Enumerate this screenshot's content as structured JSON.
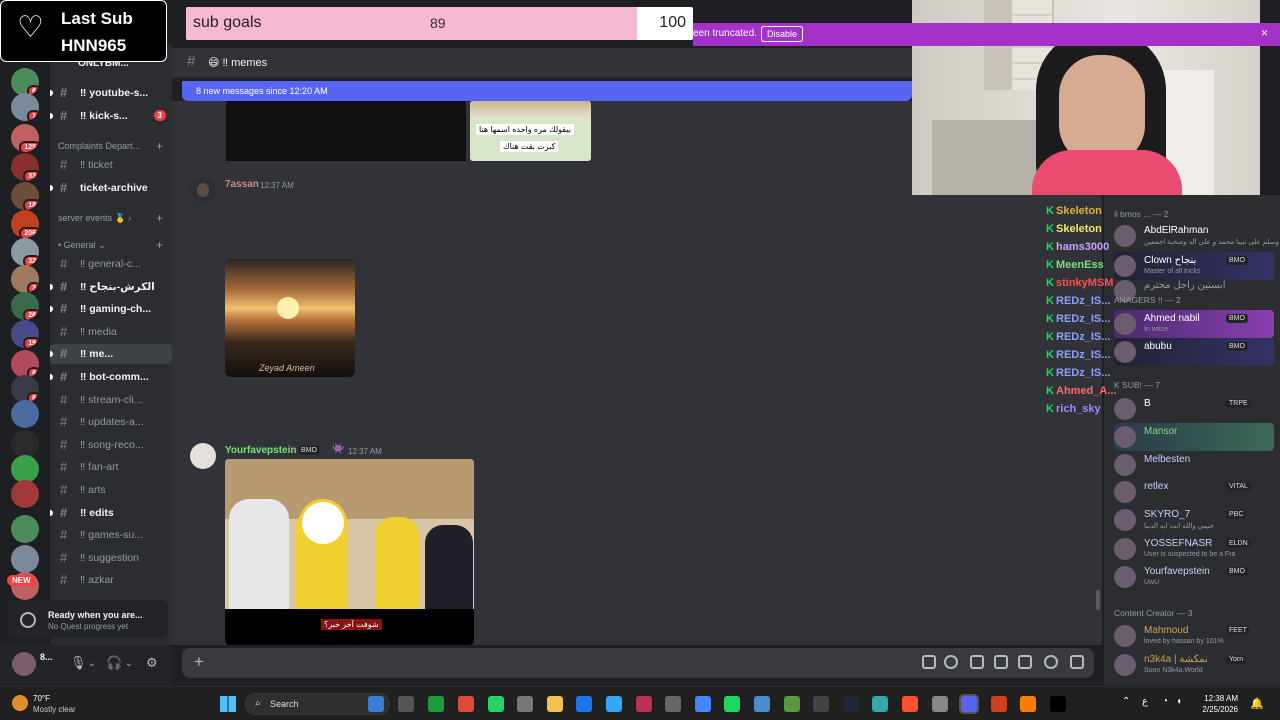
{
  "overlay": {
    "last_sub_title": "Last Sub",
    "last_sub_name": "HNN965",
    "goal_label": "sub goals",
    "goal_current": "89",
    "goal_target": "100",
    "goal_fraction": 0.89
  },
  "notice": {
    "text": "een truncated.",
    "button": "Disable"
  },
  "sidebar": {
    "server_name": "ONLYBM...",
    "channels_top": [
      {
        "label": "‼ youtube-s...",
        "icon": "heart"
      },
      {
        "label": "‼ kick-s...",
        "icon": "green-heart",
        "badge": "3"
      }
    ],
    "cat_complaints": "Complaints Depart...",
    "channels_c": [
      {
        "label": "‼ ticket"
      },
      {
        "label": "ticket-archive"
      }
    ],
    "cat_events": "server events",
    "cat_general": "General",
    "channels_g": [
      {
        "label": "‼ general-c..."
      },
      {
        "label": "‼ الكرش-بنجاح"
      },
      {
        "label": "‼ gaming-ch..."
      },
      {
        "label": "‼ media"
      },
      {
        "label": "‼ me..."
      },
      {
        "label": "‼ bot-comm..."
      },
      {
        "label": "‼ stream-cli..."
      },
      {
        "label": "‼ updates-a..."
      },
      {
        "label": "‼ song-reco..."
      },
      {
        "label": "‼ fan-art"
      },
      {
        "label": "‼ arts"
      },
      {
        "label": "‼ edits"
      },
      {
        "label": "‼ games-su..."
      },
      {
        "label": "‼ suggestion"
      },
      {
        "label": "‼ azkar"
      }
    ],
    "server_badges": [
      "6",
      "1",
      "125",
      "33",
      "18",
      "206",
      "32",
      "3",
      "26",
      "19",
      "6",
      "6"
    ],
    "new_label": "NEW",
    "quest_title": "Ready when you are...",
    "quest_sub": "No Quest progress yet",
    "user_name": "8..."
  },
  "chat": {
    "channel": "‼ memes",
    "new_messages": "8 new messages since 12:20 AM",
    "caption_top": "بيقولك مره واحده اسمها هنا",
    "caption_bottom": "كبرت بقت هناك",
    "msg1_author": "7assan",
    "msg1_time": "12:37 AM",
    "img_watermark": "Zeyad Ameen",
    "msg2_author": "Yourfavepstein",
    "msg2_tag": "BMO",
    "msg2_time": "12:37 AM",
    "video_caption": "شوفت آخر خبر؟"
  },
  "twitch": [
    {
      "name": "Skeleton",
      "color": "#e0b03a"
    },
    {
      "name": "Skeleton",
      "color": "#f2e66b"
    },
    {
      "name": "hams3000",
      "color": "#c9a0ff"
    },
    {
      "name": "MeenEss",
      "color": "#7ce07c"
    },
    {
      "name": "stinkyMSM",
      "color": "#ff4d4d"
    },
    {
      "name": "REDz_IS...",
      "color": "#8aa0ff"
    },
    {
      "name": "REDz_IS...",
      "color": "#8aa0ff"
    },
    {
      "name": "REDz_IS...",
      "color": "#8aa0ff"
    },
    {
      "name": "REDz_IS...",
      "color": "#8aa0ff"
    },
    {
      "name": "REDz_IS...",
      "color": "#8aa0ff"
    },
    {
      "name": "Ahmed_A...",
      "color": "#ff6b6b"
    },
    {
      "name": "rich_sky",
      "color": "#9b8cff"
    }
  ],
  "members": {
    "top_group": "il bmos ... — 2",
    "list1": [
      {
        "name": "AbdElRahman",
        "status": "لي وسلم على نبينا محمد و على اله وصحبة اجمعين",
        "color": "#ffffff"
      },
      {
        "name": "Clown بنجاح",
        "tag": "BMO",
        "status": "Master of all tricks",
        "color": "#ffffff"
      },
      {
        "name": "ابستين راجل محترم",
        "color": "#949ba4"
      }
    ],
    "group2": "ANAGERS !! — 2",
    "list2": [
      {
        "name": "Ahmed nabil",
        "tag": "BMO",
        "status": "In voice",
        "color": "#ffffff"
      },
      {
        "name": "abubu",
        "tag": "BMO",
        "color": "#ffffff"
      }
    ],
    "group3": "K SUB! — 7",
    "list3": [
      {
        "name": "B",
        "tag": "TRPE",
        "color": "#ffffff"
      },
      {
        "name": "Mansor",
        "color": "#7ce07c"
      },
      {
        "name": "Melbesten",
        "color": "#c7d0ff"
      },
      {
        "name": "retlex",
        "tag": "VITAL",
        "color": "#c7d0ff"
      },
      {
        "name": "SKYRO_7",
        "tag": "PBC",
        "status": "حبيبي والله انت ايه الدنيا",
        "color": "#c7d0ff"
      },
      {
        "name": "YOSSEFNASR",
        "tag": "ELDN",
        "status": "User is suspected to be a Fra",
        "color": "#c7d0ff"
      },
      {
        "name": "Yourfavepstein",
        "tag": "BMO",
        "status": "UwU",
        "color": "#c7d0ff"
      }
    ],
    "group4": "Content Creator — 3",
    "list4": [
      {
        "name": "Mahmoud",
        "tag": "FEET",
        "status": "loved by hassan by 101%",
        "color": "#c9a35b"
      },
      {
        "name": "n3k4a | نمكشة",
        "tag": "Yorn",
        "status": "Soon N3k4a.World",
        "color": "#c9a35b"
      }
    ]
  },
  "taskbar": {
    "weather_temp": "70°F",
    "weather_desc": "Mostly clear",
    "search": "Search",
    "time": "12:38 AM",
    "date": "2/25/2026"
  }
}
